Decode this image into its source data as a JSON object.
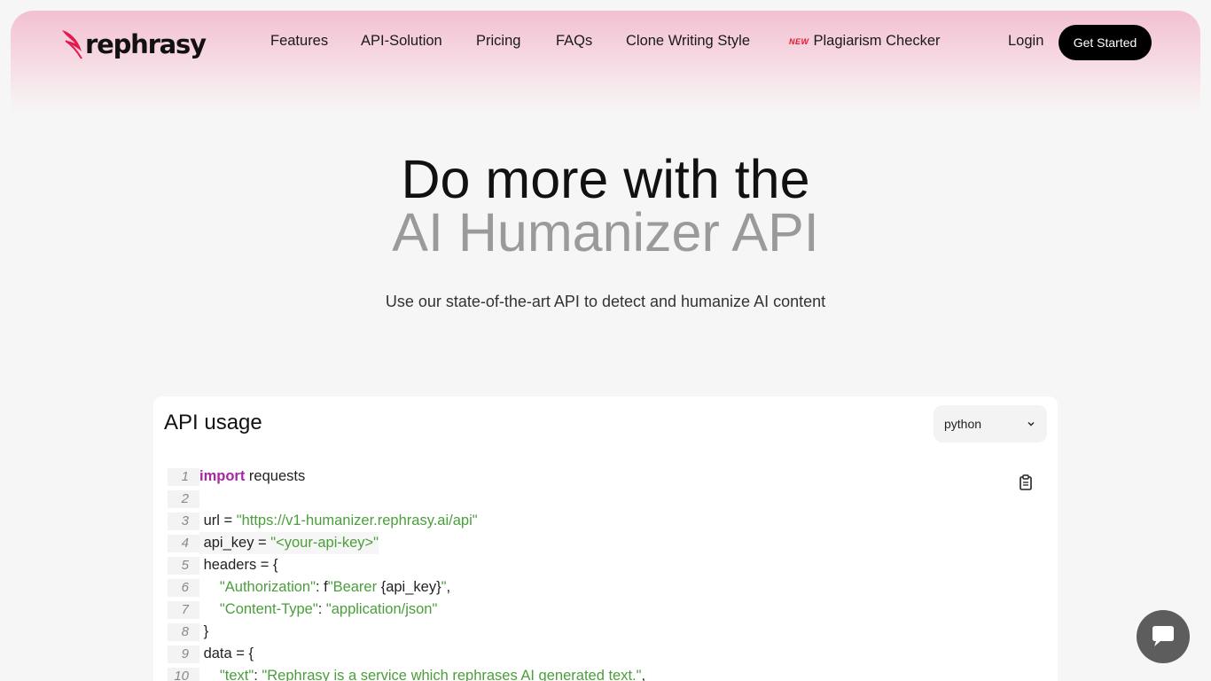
{
  "brand": {
    "name": "rephrasy",
    "accent": "#e4184f"
  },
  "nav": {
    "links": [
      "Features",
      "API-Solution",
      "Pricing",
      "FAQs",
      "Clone Writing Style"
    ],
    "new_badge": "NEW",
    "plagiarism": "Plagiarism Checker",
    "login": "Login",
    "get_started": "Get Started"
  },
  "hero": {
    "line1": "Do more with the",
    "line2": "AI Humanizer API",
    "subtitle": "Use our state-of-the-art API to detect and humanize AI content"
  },
  "api_card": {
    "title": "API usage",
    "language": "python",
    "copy_icon": "clipboard-icon",
    "lines": [
      {
        "n": "1",
        "parts": [
          {
            "t": "import",
            "c": "kw"
          },
          {
            "t": " requests",
            "c": "plain"
          }
        ]
      },
      {
        "n": "2",
        "parts": [
          {
            "t": " ",
            "c": "plain"
          }
        ]
      },
      {
        "n": "3",
        "parts": [
          {
            "t": " url = ",
            "c": "plain"
          },
          {
            "t": "\"https://v1-humanizer.rephrasy.ai/api\"",
            "c": "str"
          }
        ]
      },
      {
        "n": "4",
        "parts": [
          {
            "t": " api_key = ",
            "c": "plain"
          },
          {
            "t": "\"<your-api-key>\"",
            "c": "str"
          }
        ]
      },
      {
        "n": "5",
        "parts": [
          {
            "t": " headers = {",
            "c": "plain"
          }
        ]
      },
      {
        "n": "6",
        "parts": [
          {
            "t": "     ",
            "c": "plain"
          },
          {
            "t": "\"Authorization\"",
            "c": "str"
          },
          {
            "t": ": ",
            "c": "plain"
          },
          {
            "t": "f",
            "c": "plain"
          },
          {
            "t": "\"Bearer ",
            "c": "str"
          },
          {
            "t": "{api_key}",
            "c": "plain"
          },
          {
            "t": "\"",
            "c": "str"
          },
          {
            "t": ",",
            "c": "plain"
          }
        ]
      },
      {
        "n": "7",
        "parts": [
          {
            "t": "     ",
            "c": "plain"
          },
          {
            "t": "\"Content-Type\"",
            "c": "str"
          },
          {
            "t": ": ",
            "c": "plain"
          },
          {
            "t": "\"application/json\"",
            "c": "str"
          }
        ]
      },
      {
        "n": "8",
        "parts": [
          {
            "t": " }",
            "c": "plain"
          }
        ]
      },
      {
        "n": "9",
        "parts": [
          {
            "t": " data = {",
            "c": "plain"
          }
        ]
      },
      {
        "n": "10",
        "parts": [
          {
            "t": "     ",
            "c": "plain"
          },
          {
            "t": "\"text\"",
            "c": "str"
          },
          {
            "t": ": ",
            "c": "plain"
          },
          {
            "t": "\"Rephrasy is a service which rephrases AI generated text.\"",
            "c": "str"
          },
          {
            "t": ",",
            "c": "plain"
          }
        ]
      }
    ]
  },
  "chat_widget": {
    "icon": "chat-bubble-icon"
  }
}
